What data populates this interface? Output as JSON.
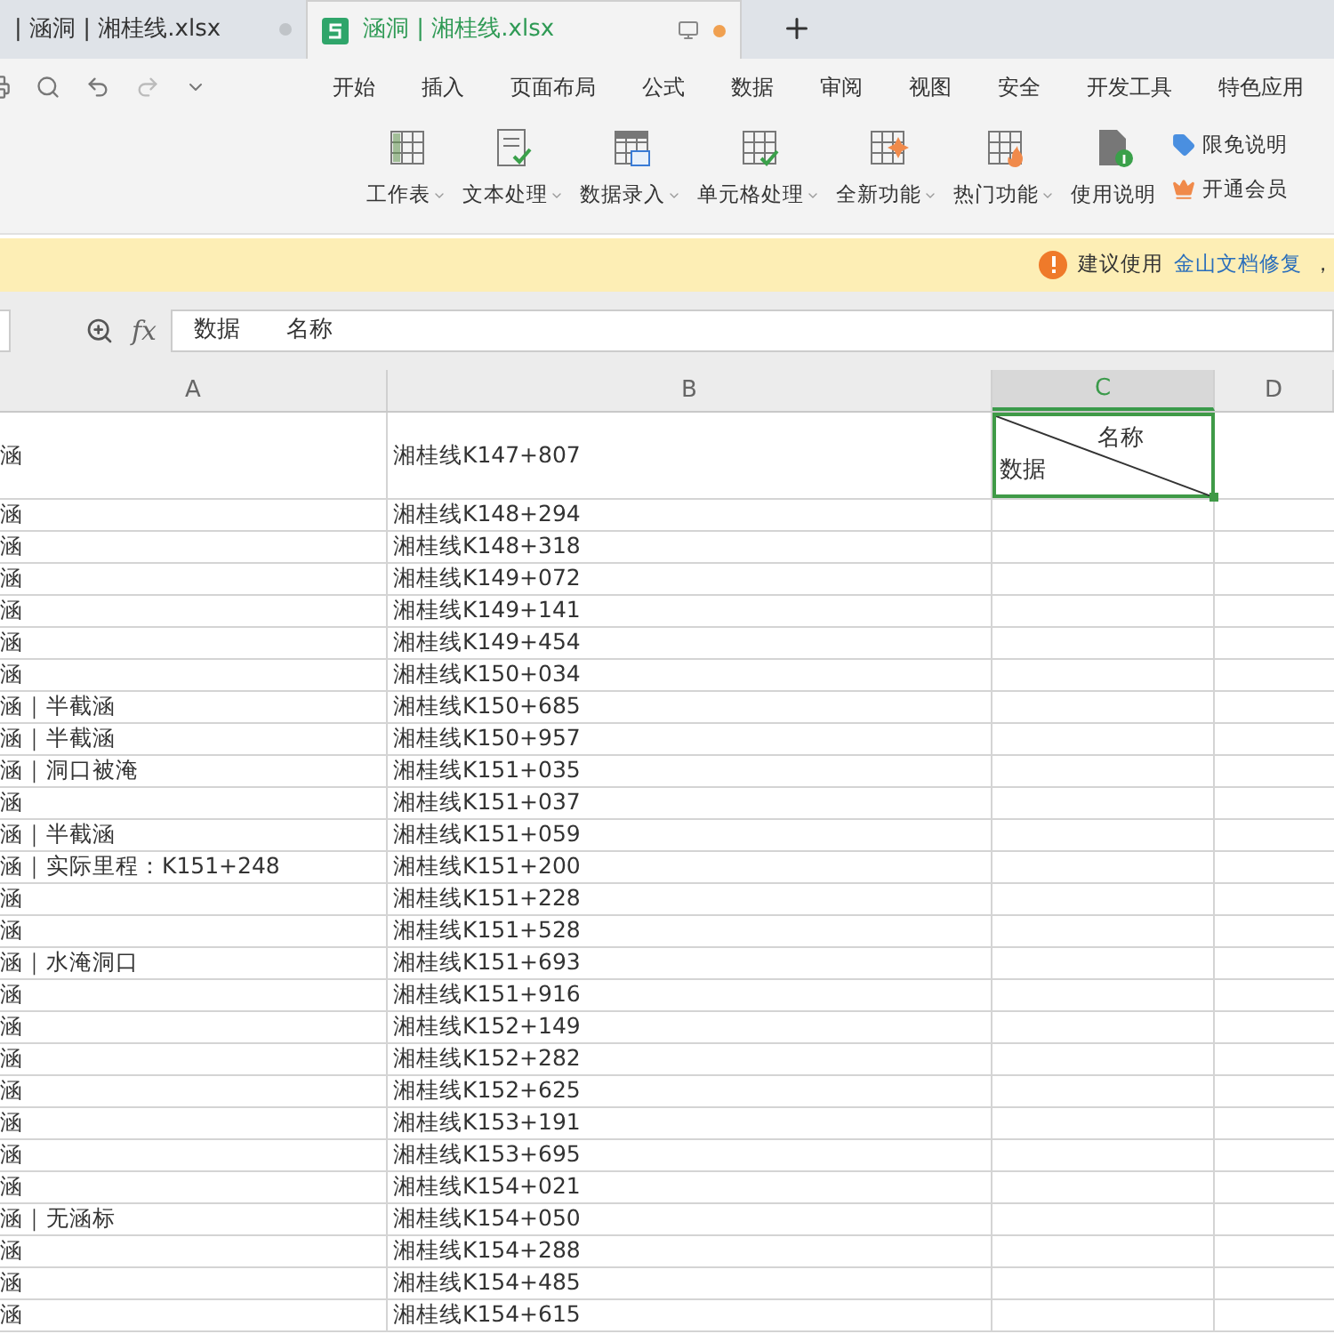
{
  "tabs": [
    {
      "label": "| 涵洞 | 湘桂线.xlsx",
      "selected": false,
      "modified": false
    },
    {
      "label": "涵洞 | 湘桂线.xlsx",
      "selected": true,
      "modified": true
    }
  ],
  "menu": [
    {
      "label": "开始"
    },
    {
      "label": "插入"
    },
    {
      "label": "页面布局"
    },
    {
      "label": "公式"
    },
    {
      "label": "数据"
    },
    {
      "label": "审阅"
    },
    {
      "label": "视图"
    },
    {
      "label": "安全"
    },
    {
      "label": "开发工具"
    },
    {
      "label": "特色应用"
    }
  ],
  "ribbon": [
    {
      "label": "工作表",
      "kind": "sheet",
      "dropdown": true
    },
    {
      "label": "文本处理",
      "kind": "text",
      "dropdown": true
    },
    {
      "label": "数据录入",
      "kind": "entry",
      "dropdown": true
    },
    {
      "label": "单元格处理",
      "kind": "cell",
      "dropdown": true
    },
    {
      "label": "全新功能",
      "kind": "new",
      "dropdown": true
    },
    {
      "label": "热门功能",
      "kind": "hot",
      "dropdown": true
    },
    {
      "label": "使用说明",
      "kind": "doc",
      "dropdown": false
    }
  ],
  "side_links": [
    {
      "label": "限免说明",
      "kind": "tag"
    },
    {
      "label": "开通会员",
      "kind": "crown"
    }
  ],
  "notice": {
    "text": "建议使用",
    "link": "金山文档修复",
    "tail": "，"
  },
  "formula_bar": {
    "fx": "fx",
    "value": "数据　　名称"
  },
  "columns": [
    {
      "label": "A",
      "selected": false
    },
    {
      "label": "B",
      "selected": false
    },
    {
      "label": "C",
      "selected": true
    },
    {
      "label": "D",
      "selected": false
    }
  ],
  "header_cell": {
    "top": "名称",
    "bottom": "数据"
  },
  "rows": [
    {
      "a": "涵",
      "b": "湘桂线K147+807"
    },
    {
      "a": "涵",
      "b": "湘桂线K148+294"
    },
    {
      "a": "涵",
      "b": "湘桂线K148+318"
    },
    {
      "a": "涵",
      "b": "湘桂线K149+072"
    },
    {
      "a": "涵",
      "b": "湘桂线K149+141"
    },
    {
      "a": "涵",
      "b": "湘桂线K149+454"
    },
    {
      "a": "涵",
      "b": "湘桂线K150+034"
    },
    {
      "a": "涵｜半截涵",
      "b": "湘桂线K150+685"
    },
    {
      "a": "涵｜半截涵",
      "b": "湘桂线K150+957"
    },
    {
      "a": "涵｜洞口被淹",
      "b": "湘桂线K151+035"
    },
    {
      "a": "涵",
      "b": "湘桂线K151+037"
    },
    {
      "a": "涵｜半截涵",
      "b": "湘桂线K151+059"
    },
    {
      "a": "涵｜实际里程：K151+248",
      "b": "湘桂线K151+200"
    },
    {
      "a": "涵",
      "b": "湘桂线K151+228"
    },
    {
      "a": "涵",
      "b": "湘桂线K151+528"
    },
    {
      "a": "涵｜水淹洞口",
      "b": "湘桂线K151+693"
    },
    {
      "a": "涵",
      "b": "湘桂线K151+916"
    },
    {
      "a": "涵",
      "b": "湘桂线K152+149"
    },
    {
      "a": "涵",
      "b": "湘桂线K152+282"
    },
    {
      "a": "涵",
      "b": "湘桂线K152+625"
    },
    {
      "a": "涵",
      "b": "湘桂线K153+191"
    },
    {
      "a": "涵",
      "b": "湘桂线K153+695"
    },
    {
      "a": "涵",
      "b": "湘桂线K154+021"
    },
    {
      "a": "涵｜无涵标",
      "b": "湘桂线K154+050"
    },
    {
      "a": "涵",
      "b": "湘桂线K154+288"
    },
    {
      "a": "涵",
      "b": "湘桂线K154+485"
    },
    {
      "a": "涵",
      "b": "湘桂线K154+615"
    }
  ]
}
